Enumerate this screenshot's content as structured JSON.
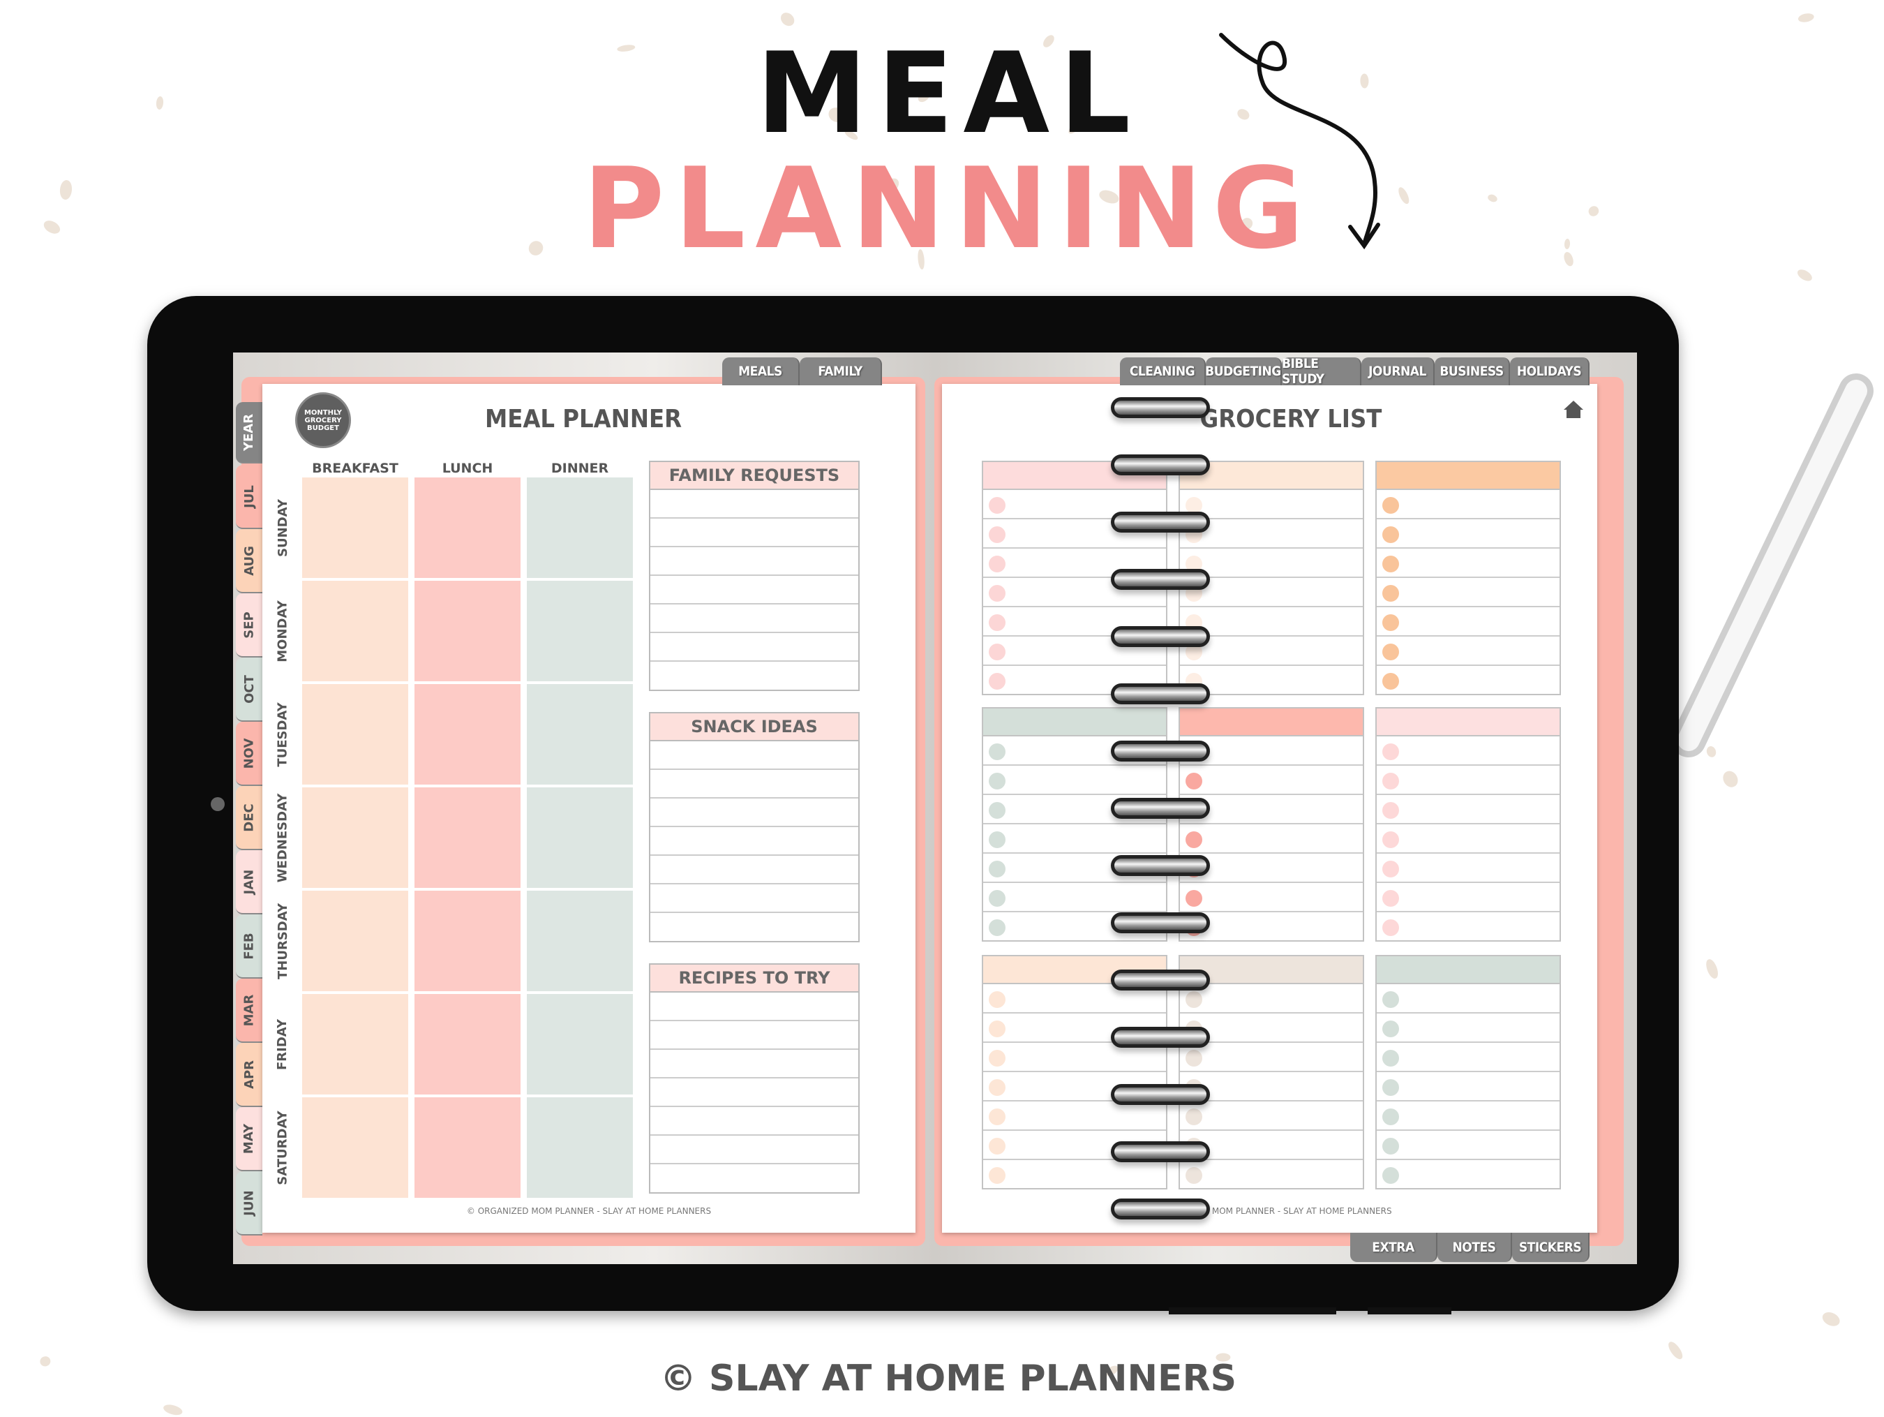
{
  "headline": {
    "line1": "MEAL",
    "line2": "PLANNING"
  },
  "credit": "© SLAY AT HOME PLANNERS",
  "colors": {
    "accent": "#f28b8b",
    "page_back": "#fbb6ac",
    "tab_gray": "#858585",
    "peach": "#fde3d3",
    "pink": "#fdcbc6",
    "sage": "#dde6e2"
  },
  "top_tabs_left": [
    "MEALS",
    "FAMILY"
  ],
  "top_tabs_right": [
    "CLEANING",
    "BUDGETING",
    "BIBLE STUDY",
    "JOURNAL",
    "BUSINESS",
    "HOLIDAYS"
  ],
  "bottom_tabs": [
    "EXTRA",
    "NOTES",
    "STICKERS"
  ],
  "side_tabs": [
    {
      "label": "YEAR",
      "color": "#858585"
    },
    {
      "label": "JUL",
      "color": "#fbb6ac"
    },
    {
      "label": "AUG",
      "color": "#fcd3b8"
    },
    {
      "label": "SEP",
      "color": "#fde0de"
    },
    {
      "label": "OCT",
      "color": "#d5e0da"
    },
    {
      "label": "NOV",
      "color": "#fbb6ac"
    },
    {
      "label": "DEC",
      "color": "#fcd3b8"
    },
    {
      "label": "JAN",
      "color": "#fde0de"
    },
    {
      "label": "FEB",
      "color": "#d5e0da"
    },
    {
      "label": "MAR",
      "color": "#fbb6ac"
    },
    {
      "label": "APR",
      "color": "#fcd3b8"
    },
    {
      "label": "MAY",
      "color": "#fde0de"
    },
    {
      "label": "JUN",
      "color": "#d5e0da"
    }
  ],
  "meal_planner": {
    "badge": "MONTHLY GROCERY BUDGET",
    "title": "MEAL PLANNER",
    "columns": [
      {
        "label": "BREAKFAST",
        "color": "#fde3d3"
      },
      {
        "label": "LUNCH",
        "color": "#fdcbc6"
      },
      {
        "label": "DINNER",
        "color": "#dde6e2"
      }
    ],
    "days": [
      "SUNDAY",
      "MONDAY",
      "TUESDAY",
      "WEDNESDAY",
      "THURSDAY",
      "FRIDAY",
      "SATURDAY"
    ],
    "sections": [
      "FAMILY REQUESTS",
      "SNACK IDEAS",
      "RECIPES TO TRY"
    ],
    "footer": "© ORGANIZED MOM PLANNER - SLAY AT HOME PLANNERS"
  },
  "grocery_list": {
    "title": "GROCERY LIST",
    "home_icon": "home-icon",
    "blocks": [
      {
        "header": "#fddcdc",
        "dot": "#fcd6d6"
      },
      {
        "header": "#fde8d8",
        "dot": "#fdeee4"
      },
      {
        "header": "#fbc9a2",
        "dot": "#f9c49a"
      },
      {
        "header": "#d4dfd9",
        "dot": "#d4dfd9"
      },
      {
        "header": "#fdb8ad",
        "dot": "#f9a8a0"
      },
      {
        "header": "#fde0e0",
        "dot": "#fdd8d8"
      },
      {
        "header": "#fde6d6",
        "dot": "#fde6d6"
      },
      {
        "header": "#ede4dc",
        "dot": "#ede4dc"
      },
      {
        "header": "#d4dfd9",
        "dot": "#d4dfd9"
      }
    ],
    "footer": "© ORGANIZED MOM PLANNER - SLAY AT HOME PLANNERS"
  }
}
